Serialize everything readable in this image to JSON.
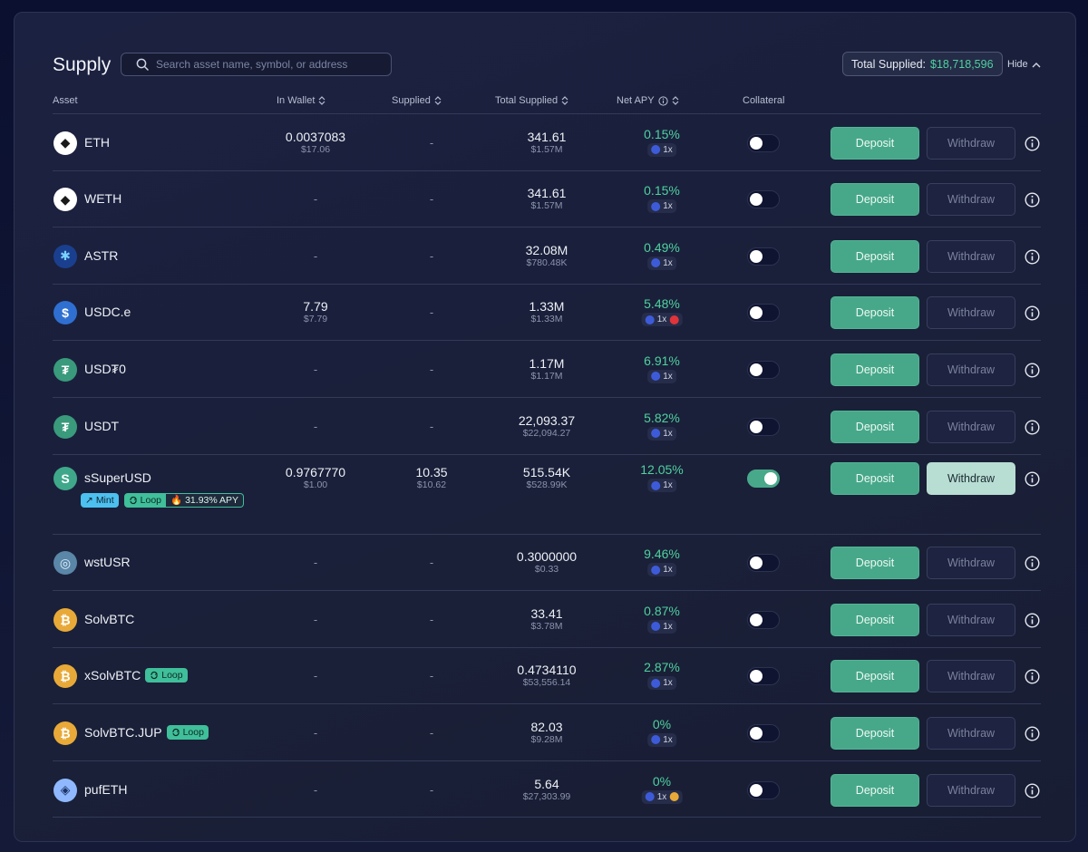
{
  "header": {
    "title": "Supply",
    "search_placeholder": "Search asset name, symbol, or address",
    "total_label": "Total Supplied:",
    "total_value": "$18,718,596",
    "hide_label": "Hide"
  },
  "columns": {
    "asset": "Asset",
    "in_wallet": "In Wallet",
    "supplied": "Supplied",
    "total_supplied": "Total Supplied",
    "net_apy": "Net APY",
    "collateral": "Collateral"
  },
  "actions": {
    "deposit": "Deposit",
    "withdraw": "Withdraw"
  },
  "tag_labels": {
    "loop": "Loop",
    "mint": "Mint",
    "apy": "31.93% APY"
  },
  "rows": [
    {
      "symbol": "ETH",
      "icon": "eth-icon",
      "wallet": "0.0037083",
      "wallet_usd": "$17.06",
      "supplied": "-",
      "supplied_usd": "",
      "total": "341.61",
      "total_usd": "$1.57M",
      "apy": "0.15%",
      "mult": "1x",
      "collateral": false
    },
    {
      "symbol": "WETH",
      "icon": "weth-icon",
      "wallet": "-",
      "wallet_usd": "",
      "supplied": "-",
      "supplied_usd": "",
      "total": "341.61",
      "total_usd": "$1.57M",
      "apy": "0.15%",
      "mult": "1x",
      "collateral": false
    },
    {
      "symbol": "ASTR",
      "icon": "astr-icon",
      "wallet": "-",
      "wallet_usd": "",
      "supplied": "-",
      "supplied_usd": "",
      "total": "32.08M",
      "total_usd": "$780.48K",
      "apy": "0.49%",
      "mult": "1x",
      "collateral": false
    },
    {
      "symbol": "USDC.e",
      "icon": "usdc-icon",
      "wallet": "7.79",
      "wallet_usd": "$7.79",
      "supplied": "-",
      "supplied_usd": "",
      "total": "1.33M",
      "total_usd": "$1.33M",
      "apy": "5.48%",
      "mult": "1x",
      "collateral": false,
      "extra": "op-icon"
    },
    {
      "symbol": "USD₮0",
      "icon": "usdt0-icon",
      "wallet": "-",
      "wallet_usd": "",
      "supplied": "-",
      "supplied_usd": "",
      "total": "1.17M",
      "total_usd": "$1.17M",
      "apy": "6.91%",
      "mult": "1x",
      "collateral": false
    },
    {
      "symbol": "USDT",
      "icon": "usdt-icon",
      "wallet": "-",
      "wallet_usd": "",
      "supplied": "-",
      "supplied_usd": "",
      "total": "22,093.37",
      "total_usd": "$22,094.27",
      "apy": "5.82%",
      "mult": "1x",
      "collateral": false
    },
    {
      "symbol": "sSuperUSD",
      "icon": "ssuperusd-icon",
      "wallet": "0.9767770",
      "wallet_usd": "$1.00",
      "supplied": "10.35",
      "supplied_usd": "$10.62",
      "total": "515.54K",
      "total_usd": "$528.99K",
      "apy": "12.05%",
      "mult": "1x",
      "collateral": true,
      "tags": [
        "mint",
        "loop",
        "apy"
      ]
    },
    {
      "symbol": "wstUSR",
      "icon": "wstusr-icon",
      "wallet": "-",
      "wallet_usd": "",
      "supplied": "-",
      "supplied_usd": "",
      "total": "0.3000000",
      "total_usd": "$0.33",
      "apy": "9.46%",
      "mult": "1x",
      "collateral": false
    },
    {
      "symbol": "SolvBTC",
      "icon": "solvbtc-icon",
      "wallet": "-",
      "wallet_usd": "",
      "supplied": "-",
      "supplied_usd": "",
      "total": "33.41",
      "total_usd": "$3.78M",
      "apy": "0.87%",
      "mult": "1x",
      "collateral": false
    },
    {
      "symbol": "xSolvBTC",
      "icon": "xsolvbtc-icon",
      "wallet": "-",
      "wallet_usd": "",
      "supplied": "-",
      "supplied_usd": "",
      "total": "0.4734110",
      "total_usd": "$53,556.14",
      "apy": "2.87%",
      "mult": "1x",
      "collateral": false,
      "inline_tag": "loop"
    },
    {
      "symbol": "SolvBTC.JUP",
      "icon": "solvbtc-jup-icon",
      "wallet": "-",
      "wallet_usd": "",
      "supplied": "-",
      "supplied_usd": "",
      "total": "82.03",
      "total_usd": "$9.28M",
      "apy": "0%",
      "mult": "1x",
      "collateral": false,
      "inline_tag": "loop"
    },
    {
      "symbol": "pufETH",
      "icon": "pufeth-icon",
      "wallet": "-",
      "wallet_usd": "",
      "supplied": "-",
      "supplied_usd": "",
      "total": "5.64",
      "total_usd": "$27,303.99",
      "apy": "0%",
      "mult": "1x",
      "collateral": false,
      "extra": "puffer-icon"
    }
  ]
}
